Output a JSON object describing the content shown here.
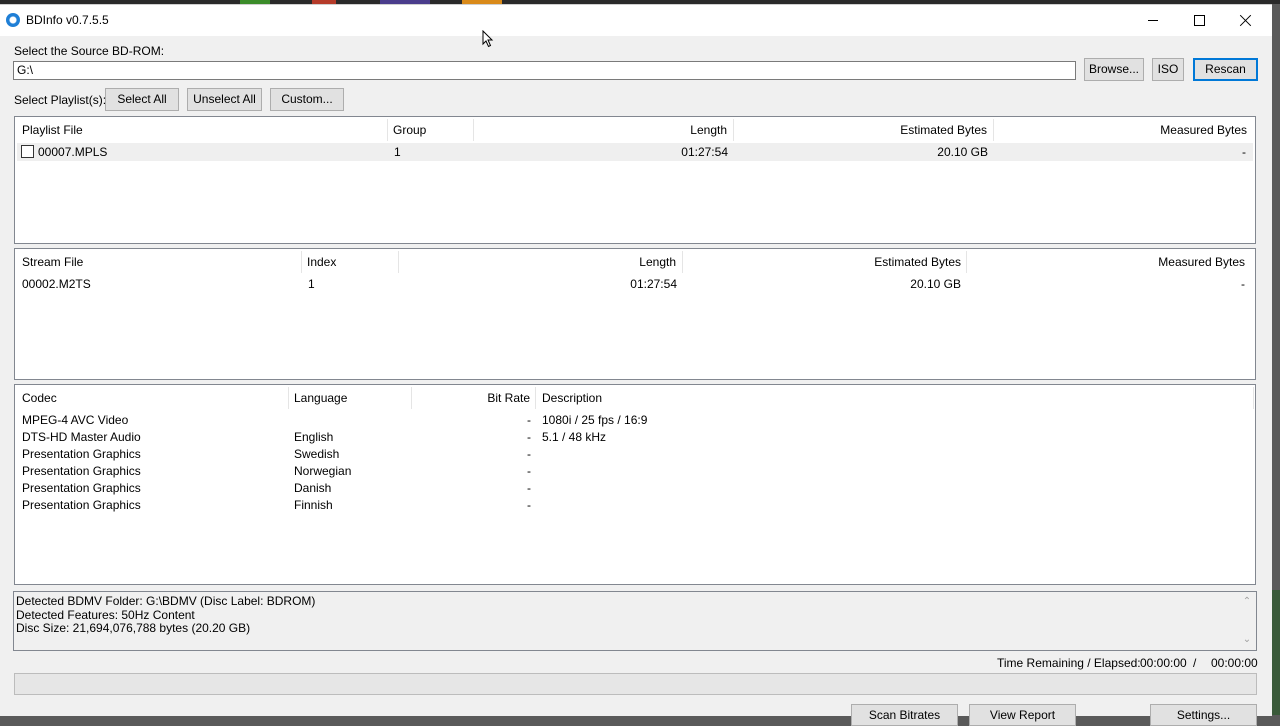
{
  "window": {
    "title": "BDInfo v0.7.5.5"
  },
  "source": {
    "label": "Select the Source BD-ROM:",
    "path": "G:\\",
    "browse": "Browse...",
    "iso": "ISO",
    "rescan": "Rescan"
  },
  "playlists": {
    "label": "Select Playlist(s):",
    "select_all": "Select All",
    "unselect_all": "Unselect All",
    "custom": "Custom...",
    "columns": [
      "Playlist File",
      "Group",
      "Length",
      "Estimated Bytes",
      "Measured Bytes"
    ],
    "rows": [
      {
        "file": "00007.MPLS",
        "group": "1",
        "length": "01:27:54",
        "estimated": "20.10 GB",
        "measured": "-",
        "checked": false
      }
    ]
  },
  "streams": {
    "columns": [
      "Stream File",
      "Index",
      "Length",
      "Estimated Bytes",
      "Measured Bytes"
    ],
    "rows": [
      {
        "file": "00002.M2TS",
        "index": "1",
        "length": "01:27:54",
        "estimated": "20.10 GB",
        "measured": "-"
      }
    ]
  },
  "codecs": {
    "columns": [
      "Codec",
      "Language",
      "Bit Rate",
      "Description"
    ],
    "rows": [
      {
        "codec": "MPEG-4 AVC Video",
        "language": "",
        "bitrate": "-",
        "description": "1080i / 25 fps / 16:9"
      },
      {
        "codec": "DTS-HD Master Audio",
        "language": "English",
        "bitrate": "-",
        "description": "5.1 / 48 kHz"
      },
      {
        "codec": "Presentation Graphics",
        "language": "Swedish",
        "bitrate": "-",
        "description": ""
      },
      {
        "codec": "Presentation Graphics",
        "language": "Norwegian",
        "bitrate": "-",
        "description": ""
      },
      {
        "codec": "Presentation Graphics",
        "language": "Danish",
        "bitrate": "-",
        "description": ""
      },
      {
        "codec": "Presentation Graphics",
        "language": "Finnish",
        "bitrate": "-",
        "description": ""
      }
    ]
  },
  "info": {
    "lines": [
      "Detected BDMV Folder: G:\\BDMV (Disc Label: BDROM)",
      "Detected Features: 50Hz Content",
      "Disc Size: 21,694,076,788 bytes (20.20 GB)"
    ]
  },
  "time": {
    "label": "Time Remaining / Elapsed:",
    "remaining": "00:00:00",
    "slash": "/",
    "elapsed": "00:00:00"
  },
  "progress": {
    "value": 0
  },
  "bottom_buttons": {
    "scan": "Scan Bitrates",
    "report": "View Report",
    "settings": "Settings..."
  }
}
